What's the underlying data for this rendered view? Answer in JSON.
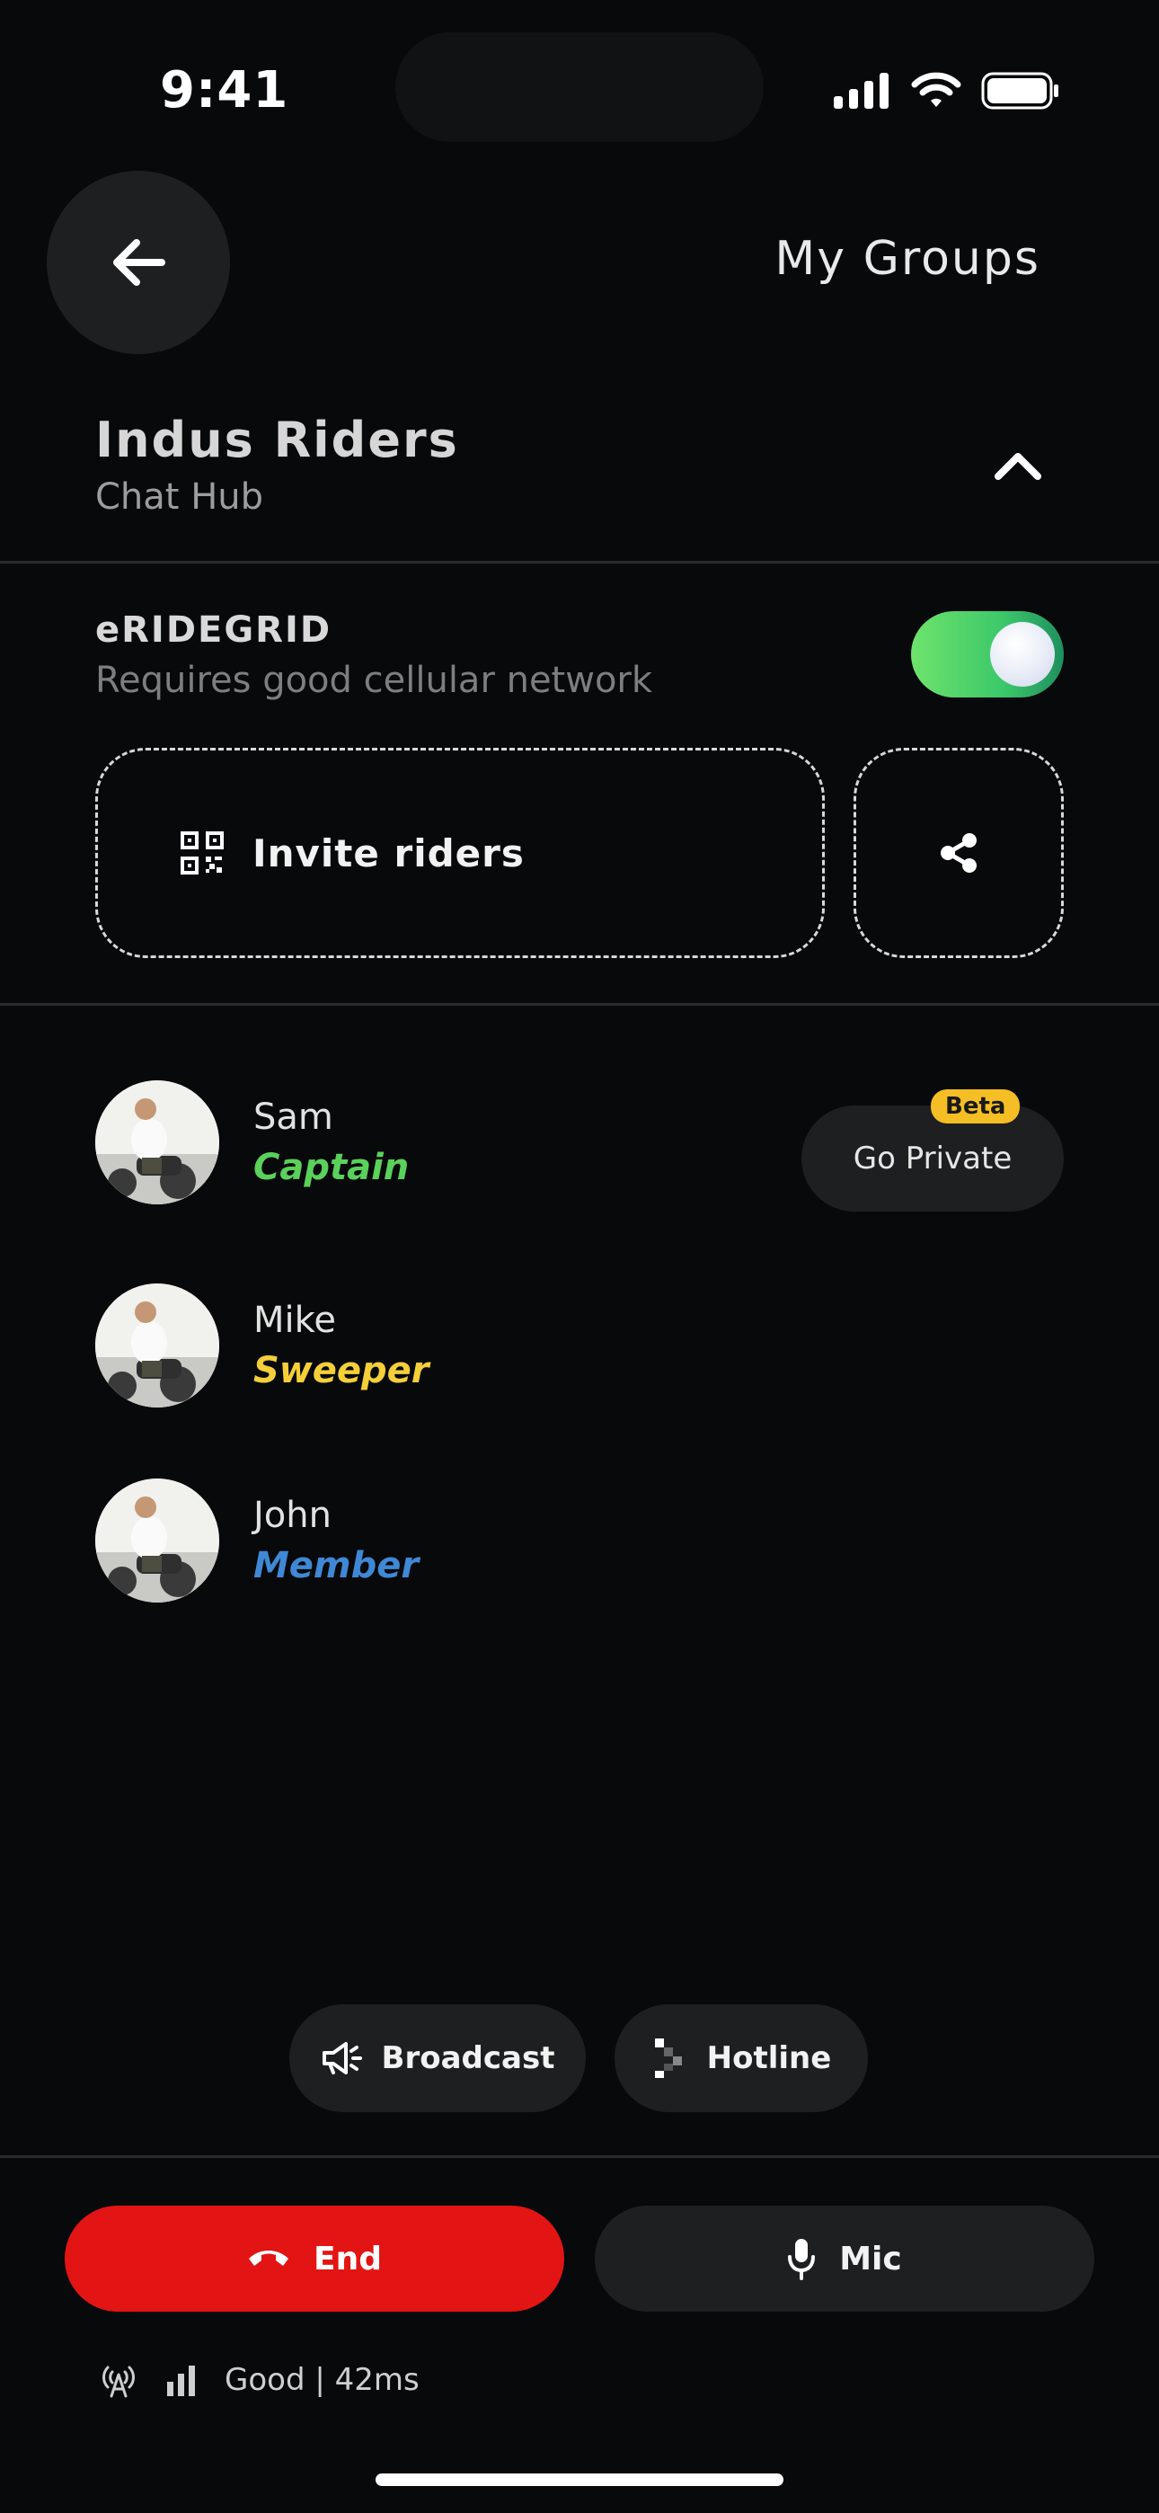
{
  "status_bar": {
    "time": "9:41"
  },
  "header": {
    "back_icon": "arrow-left-icon",
    "link_label": "My Groups"
  },
  "group": {
    "title": "Indus Riders",
    "subtitle": "Chat Hub",
    "collapse_icon": "chevron-up-icon"
  },
  "eridegrid": {
    "title": "eRIDEGRID",
    "subtitle": "Requires good cellular network",
    "enabled": true,
    "toggle_color": "#4fd46a"
  },
  "invite": {
    "label": "Invite riders",
    "icon": "qr-code-icon",
    "share_icon": "share-icon"
  },
  "riders": [
    {
      "name": "Sam",
      "role": "Captain",
      "role_color": "#5ad15a"
    },
    {
      "name": "Mike",
      "role": "Sweeper",
      "role_color": "#f4cf3a"
    },
    {
      "name": "John",
      "role": "Member",
      "role_color": "#3f88d6"
    }
  ],
  "private": {
    "label": "Go Private",
    "badge": "Beta",
    "badge_color": "#f4be24"
  },
  "actions": {
    "broadcast_label": "Broadcast",
    "broadcast_icon": "megaphone-icon",
    "hotline_label": "Hotline",
    "hotline_icon": "hotline-icon"
  },
  "call": {
    "end_label": "End",
    "end_icon": "phone-hangup-icon",
    "end_color": "#e31414",
    "mic_label": "Mic",
    "mic_icon": "microphone-icon"
  },
  "network": {
    "status_text": "Good | 42ms"
  }
}
